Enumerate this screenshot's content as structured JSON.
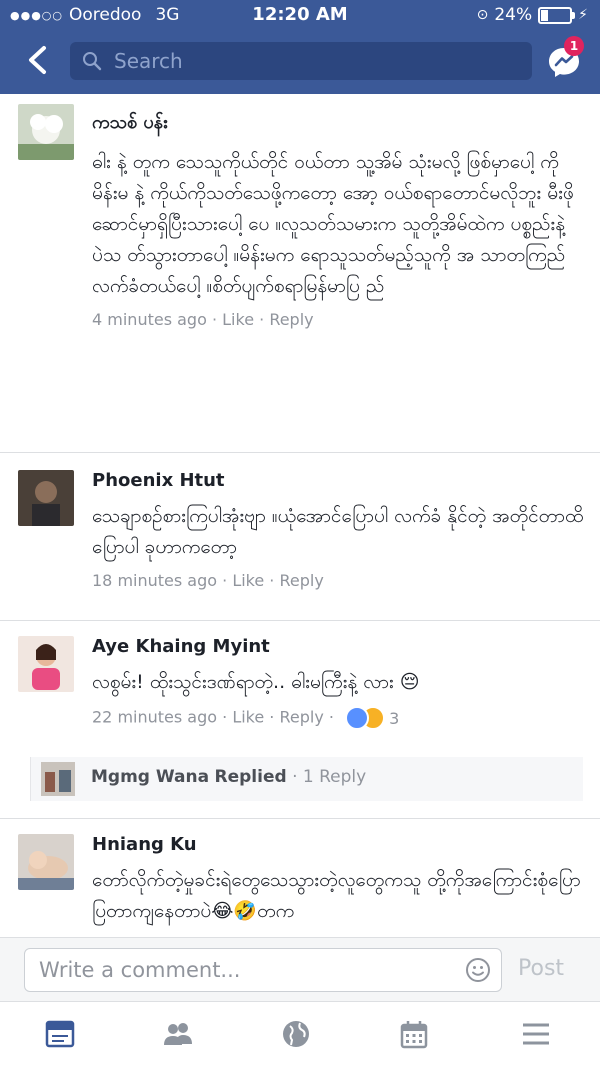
{
  "status_bar": {
    "carrier": "Ooredoo",
    "network": "3G",
    "time": "12:20 AM",
    "battery_percent": "24%",
    "battery_level": 0.24
  },
  "header": {
    "search_placeholder": "Search",
    "messenger_badge": "1"
  },
  "comments": [
    {
      "name": "ကသစ် ပန်း",
      "text": "ဓါး နဲ့ တူက သေသူကိုယ်တိုင် ဝယ်တာ သူ့အိမ် သုံးမလို့ ဖြစ်မှာပေါ့ ကိုမိန်းမ နဲ့ ကိုယ်ကိုသတ်သေဖို့ကတော့ အော့ ဝယ်စရာတောင်မလိုဘူး မီးဖိုဆောင်မှာရှိပြီးသားပေါ့ ပေ ။လူသတ်သမားက သူတို့အိမ်ထဲက ပစ္စည်းနဲ့ ပဲသ တ်သွားတာပေါ့ ။မိန်းမက ရောသူသတ်မည့်သူကို အ သာတကြည်လက်ခံတယ်ပေါ့ ။စိတ်ပျက်စရာမြန်မာပြ ည်",
      "time": "4 minutes ago",
      "like": "Like",
      "reply": "Reply"
    },
    {
      "name": "Phoenix Htut",
      "text": "သေချာစဥ်စားကြပါအုံးဗျာ ။ယုံအောင်ပြောပါ လက်ခံ နိုင်တဲ့ အတိုင်တာထိပြောပါ ခုဟာကတော့",
      "time": "18 minutes ago",
      "like": "Like",
      "reply": "Reply"
    },
    {
      "name": "Aye Khaing Myint",
      "text": "လစွမ်း! ထိုးသွင်းဒဏ်ရာတဲ့.. ဓါးမကြီးနဲ့ လား 😔",
      "time": "22 minutes ago",
      "like": "Like",
      "reply": "Reply",
      "reaction_count": "3",
      "replied": {
        "name": "Mgmg Wana",
        "action": "Replied",
        "count": "· 1 Reply"
      }
    },
    {
      "name": "Hniang Ku",
      "text": "တော်လိုက်တဲ့မှုခင်းရဲတွေသေသွားတဲ့လူတွေကသူ တို့ကိုအကြောင်းစုံပြောပြတာကျနေတာပဲ😂🤣တက"
    }
  ],
  "composer": {
    "placeholder": "Write a comment...",
    "post_label": "Post"
  },
  "tabbar": {
    "icons": [
      "news-feed-icon",
      "friends-icon",
      "globe-icon",
      "calendar-icon",
      "menu-icon"
    ]
  },
  "colors": {
    "brand": "#3b5998",
    "link_meta": "#90949c",
    "badge": "#e0245e"
  }
}
